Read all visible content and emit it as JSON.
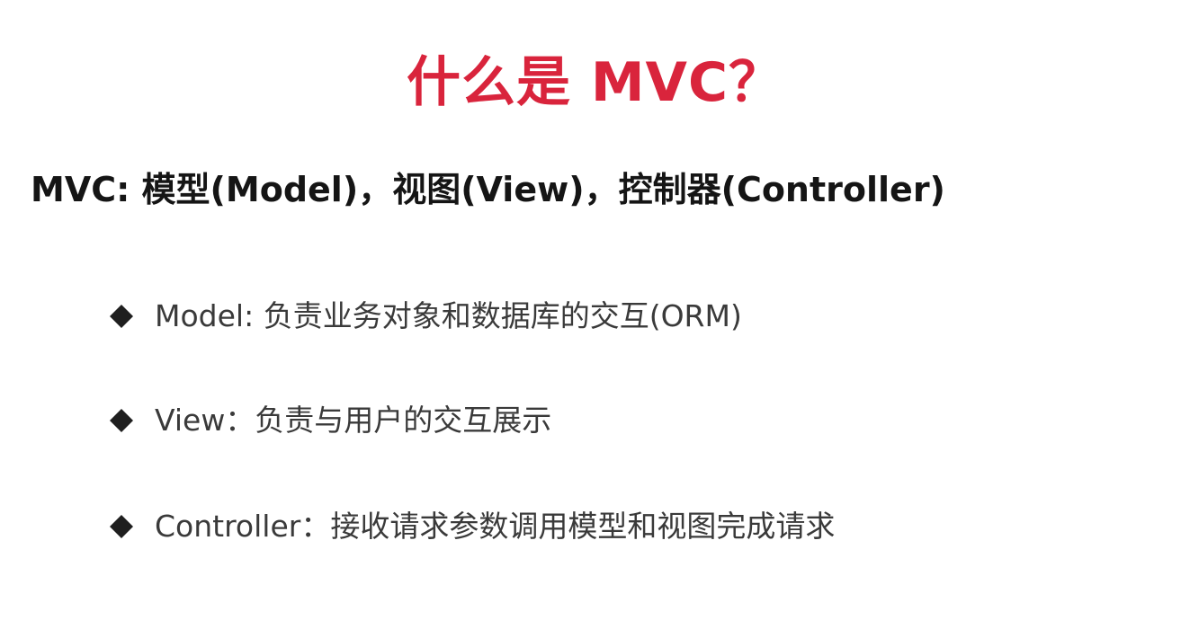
{
  "slide": {
    "title": "什么是 MVC？",
    "subtitle": "MVC: 模型(Model)，视图(View)，控制器(Controller)",
    "bullets": [
      {
        "icon": "diamond-bullet-icon",
        "text": "Model: 负责业务对象和数据库的交互(ORM)"
      },
      {
        "icon": "diamond-bullet-icon",
        "text": "View：负责与用户的交互展示"
      },
      {
        "icon": "diamond-bullet-icon",
        "text": "Controller：接收请求参数调用模型和视图完成请求"
      }
    ]
  },
  "colors": {
    "title": "#d9243c",
    "subtitle": "#151515",
    "bullet_text": "#3a3a3a",
    "background": "#ffffff"
  }
}
